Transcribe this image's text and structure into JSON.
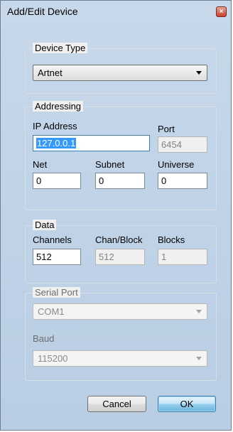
{
  "window": {
    "title": "Add/Edit Device",
    "close_glyph": "×"
  },
  "device_type": {
    "label": "Device Type",
    "selected": "Artnet"
  },
  "addressing": {
    "label": "Addressing",
    "ip_label": "IP Address",
    "ip_value": "127.0.0.1",
    "port_label": "Port",
    "port_value": "6454",
    "net_label": "Net",
    "net_value": "0",
    "subnet_label": "Subnet",
    "subnet_value": "0",
    "universe_label": "Universe",
    "universe_value": "0"
  },
  "data": {
    "label": "Data",
    "channels_label": "Channels",
    "channels_value": "512",
    "chan_block_label": "Chan/Block",
    "chan_block_value": "512",
    "blocks_label": "Blocks",
    "blocks_value": "1"
  },
  "serial": {
    "label": "Serial Port",
    "port_selected": "COM1",
    "baud_label": "Baud",
    "baud_selected": "115200"
  },
  "buttons": {
    "cancel": "Cancel",
    "ok": "OK"
  },
  "icons": {
    "close": "close-icon",
    "dropdown": "chevron-down-icon"
  }
}
